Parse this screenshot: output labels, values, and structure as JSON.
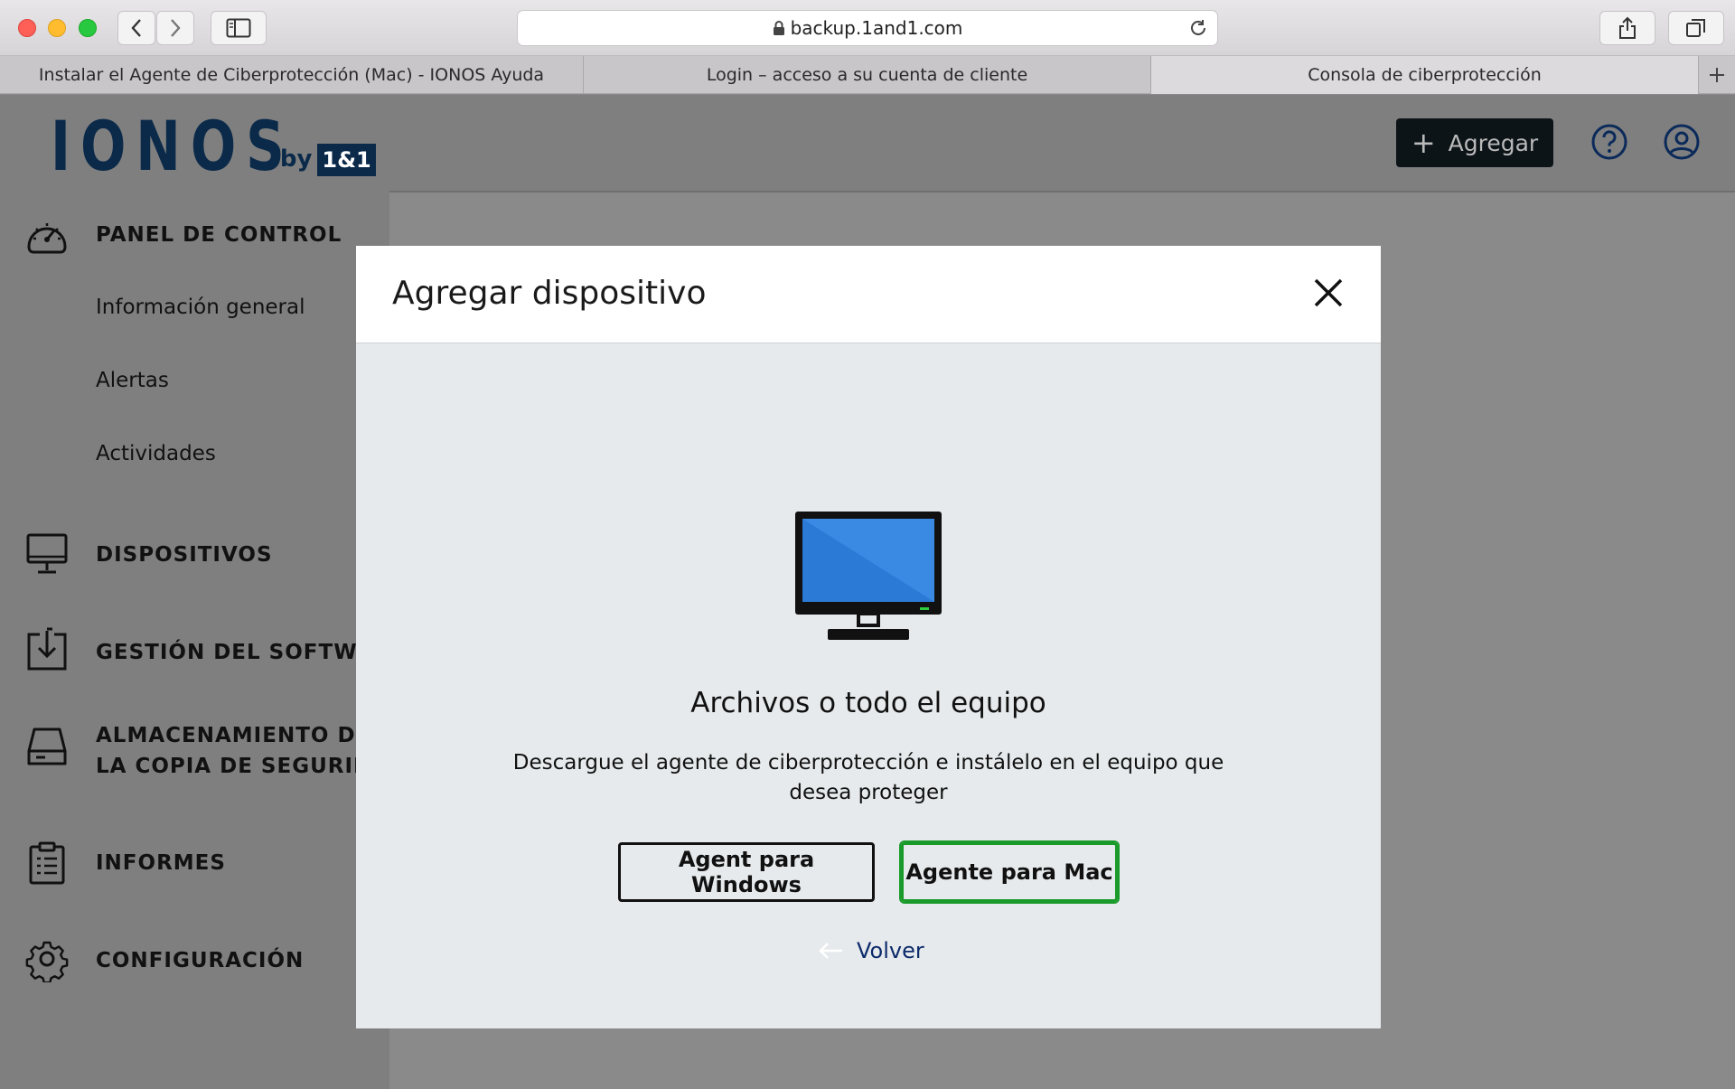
{
  "browser": {
    "url": "backup.1and1.com",
    "tabs": [
      {
        "label": "Instalar el Agente de Ciberprotección (Mac) - IONOS Ayuda",
        "active": false
      },
      {
        "label": "Login – acceso a su cuenta de cliente",
        "active": false
      },
      {
        "label": "Consola de ciberprotección",
        "active": true
      }
    ]
  },
  "header": {
    "logo_word": "IONOS",
    "logo_by": "by",
    "logo_box": "1&1",
    "add_button": "Agregar",
    "help_icon": "help-circle-icon",
    "account_icon": "user-circle-icon"
  },
  "sidebar": {
    "panel": "PANEL DE CONTROL",
    "sub_items": [
      "Información general",
      "Alertas",
      "Actividades"
    ],
    "devices": "DISPOSITIVOS",
    "software": "GESTIÓN DEL SOFTWARE",
    "storage_line1": "ALMACENAMIENTO DE",
    "storage_line2": "LA COPIA DE SEGURIDAD",
    "reports": "INFORMES",
    "settings": "CONFIGURACIÓN"
  },
  "modal": {
    "title": "Agregar dispositivo",
    "heading": "Archivos o todo el equipo",
    "description": "Descargue el agente de ciberprotección e instálelo en el equipo que desea proteger",
    "btn_windows": "Agent para Windows",
    "btn_mac": "Agente para Mac",
    "back": "Volver"
  },
  "colors": {
    "brand": "#0b2a4a",
    "selected_outline": "#1a9a2a",
    "monitor_screen": "#2a7ad6"
  }
}
